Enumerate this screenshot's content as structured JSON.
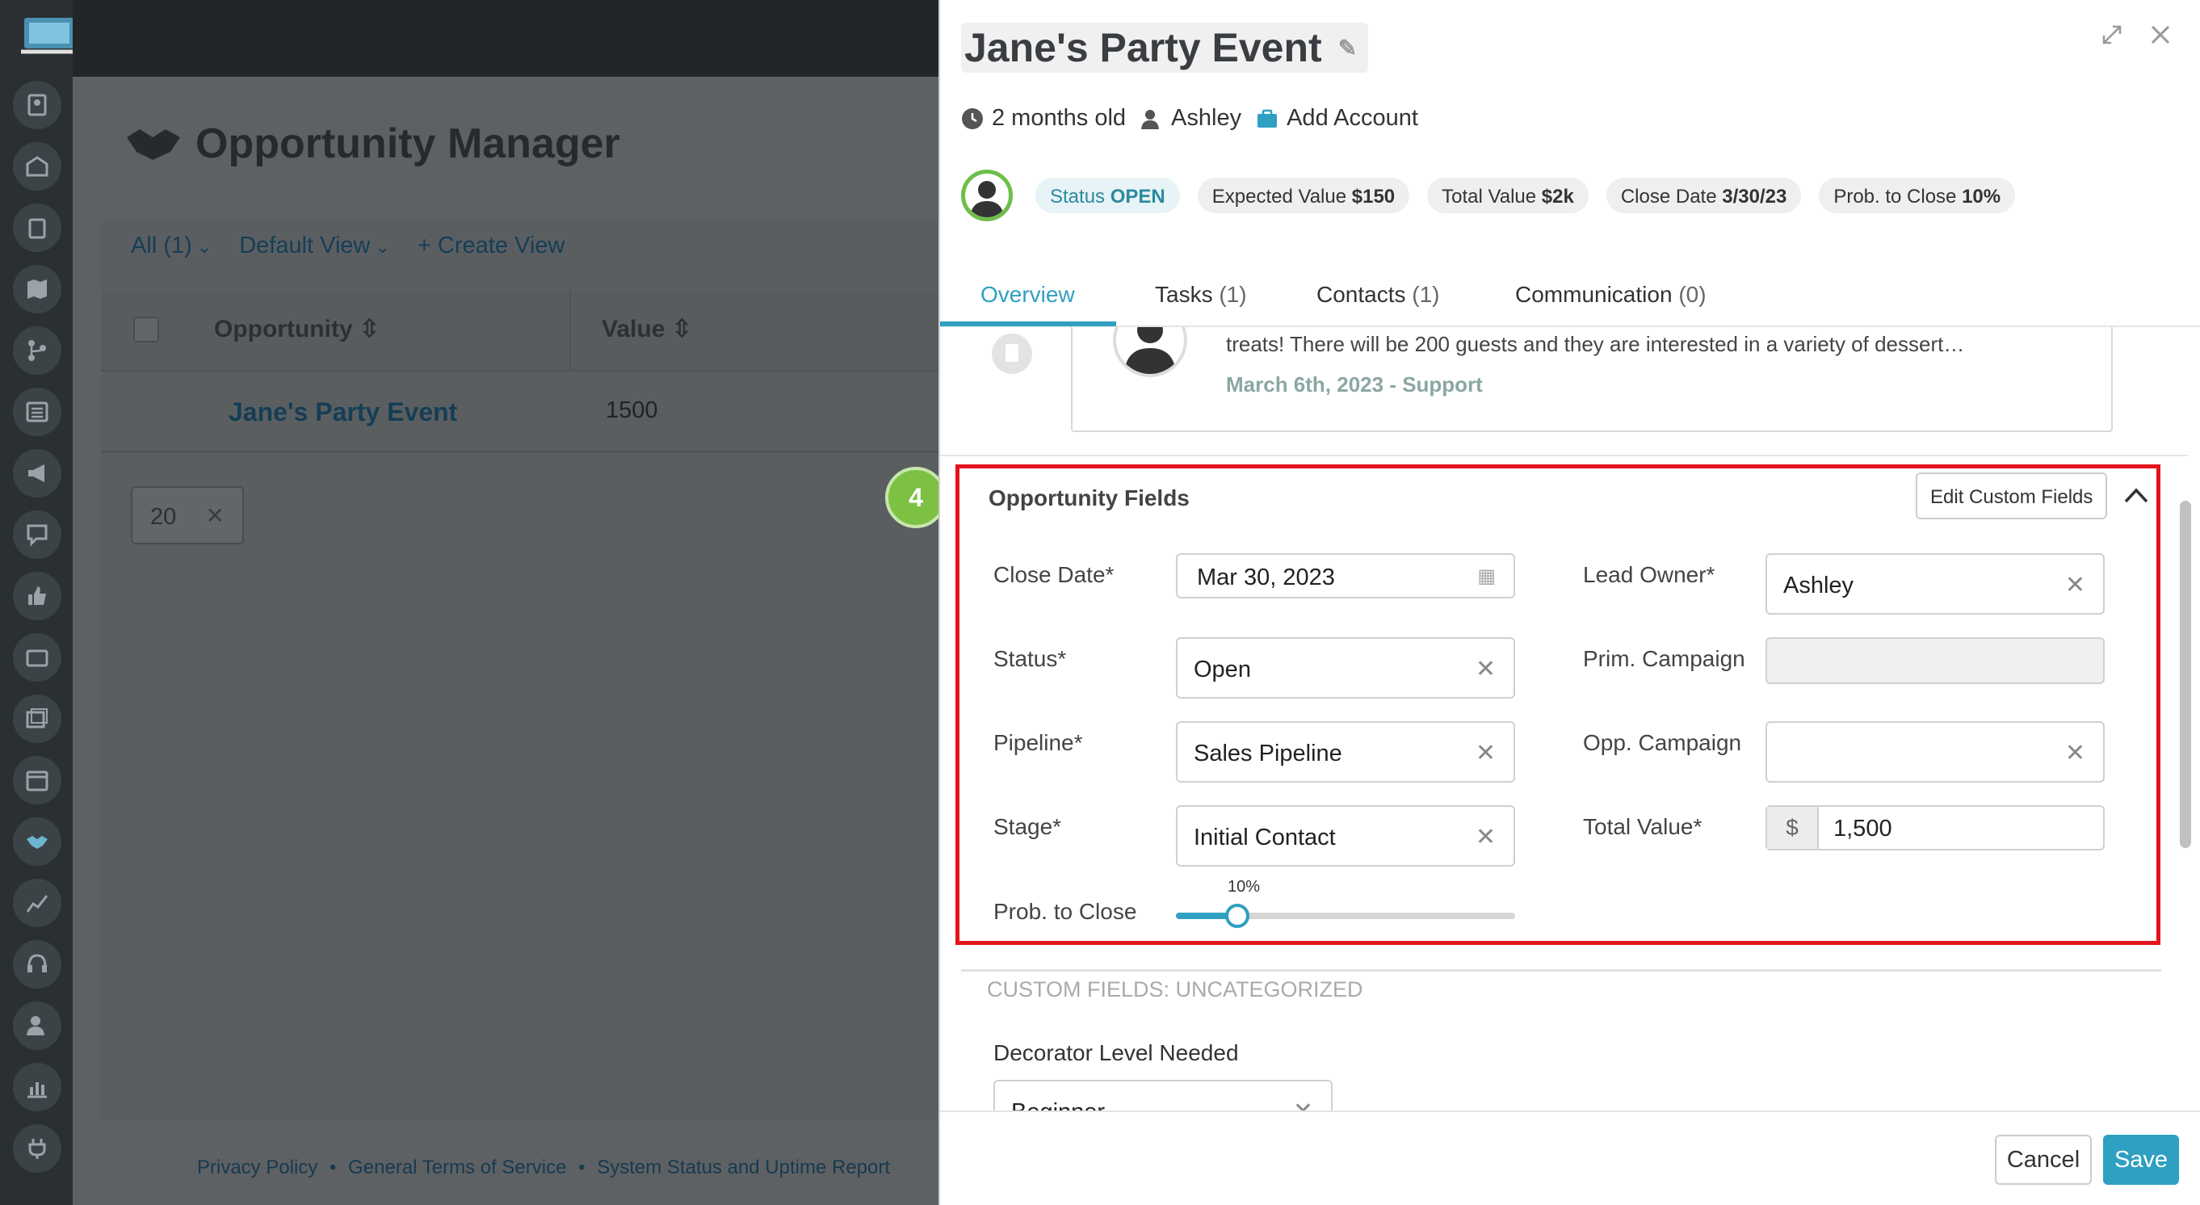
{
  "background": {
    "header": {
      "title": "Opportunity Manager"
    },
    "nav": {
      "all": "All",
      "all_count": "(1)",
      "view": "Default View",
      "create": "+ Create View"
    },
    "table": {
      "columns": [
        "Opportunity",
        "Value"
      ],
      "rows": [
        {
          "opportunity": "Jane's Party Event",
          "value": "1500"
        }
      ]
    },
    "pager": {
      "per_page": "20"
    },
    "footer": {
      "privacy": "Privacy Policy",
      "terms": "General Terms of Service",
      "status": "System Status and Uptime Report",
      "sep": "•"
    }
  },
  "drawer": {
    "title": "Jane's Party Event",
    "meta": {
      "age": "2 months old",
      "owner": "Ashley",
      "account": "Add Account"
    },
    "badges": {
      "status_label": "Status",
      "status_value": "OPEN",
      "expected_label": "Expected Value",
      "expected_value": "$150",
      "total_label": "Total Value",
      "total_value": "$2k",
      "close_label": "Close Date",
      "close_value": "3/30/23",
      "prob_label": "Prob. to Close",
      "prob_value": "10%"
    },
    "tabs": [
      {
        "label": "Overview",
        "count": ""
      },
      {
        "label": "Tasks",
        "count": "(1)"
      },
      {
        "label": "Contacts",
        "count": "(1)"
      },
      {
        "label": "Communication",
        "count": "(0)"
      }
    ],
    "note": {
      "text": "treats! There will be 200 guests and they are interested in a variety of dessert…",
      "date": "March 6th, 2023 - Support"
    },
    "step_number": "4",
    "opportunity_fields": {
      "title": "Opportunity Fields",
      "edit_button": "Edit Custom Fields",
      "close_date": {
        "label": "Close Date*",
        "value": "Mar 30, 2023"
      },
      "status": {
        "label": "Status*",
        "value": "Open"
      },
      "pipeline": {
        "label": "Pipeline*",
        "value": "Sales Pipeline"
      },
      "stage": {
        "label": "Stage*",
        "value": "Initial Contact"
      },
      "prob_to_close": {
        "label": "Prob. to Close",
        "value_label": "10%",
        "value": 0.1
      },
      "lead_owner": {
        "label": "Lead Owner*",
        "value": "Ashley"
      },
      "prim_campaign": {
        "label": "Prim. Campaign",
        "value": ""
      },
      "opp_campaign": {
        "label": "Opp. Campaign",
        "value": ""
      },
      "total_value": {
        "label": "Total Value*",
        "currency": "$",
        "value": "1,500"
      }
    },
    "custom_fields": {
      "title": "CUSTOM FIELDS: UNCATEGORIZED",
      "decorator_label": "Decorator Level Needed",
      "decorator_value": "Beginner"
    },
    "footer": {
      "cancel": "Cancel",
      "save": "Save"
    }
  },
  "colors": {
    "accent": "#2fa0c1",
    "highlight": "#e3141c",
    "step_badge": "#7cc142"
  }
}
